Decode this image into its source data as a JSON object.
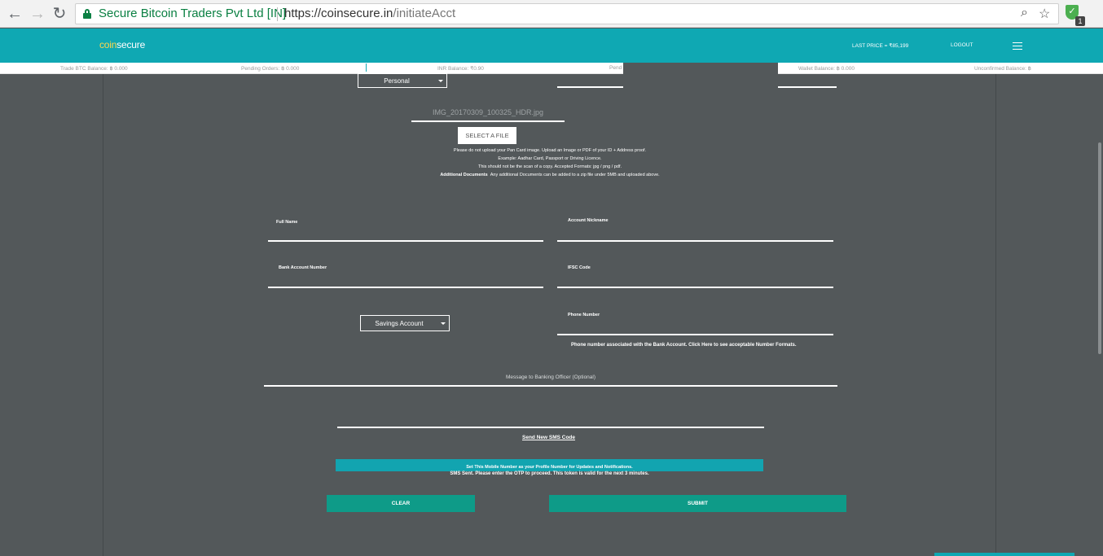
{
  "browser": {
    "site_name": "Secure Bitcoin Traders Pvt Ltd [IN]",
    "url_host": "https://coinsecure.in",
    "url_path": "/initiateAcct",
    "extension_badge": "1"
  },
  "header": {
    "logo_part1": "coin",
    "logo_part2": "secure",
    "last_price": "LAST PRICE = ₹85,199",
    "logout": "LOGOUT"
  },
  "balances": [
    {
      "label": "Trade BTC Balance: ฿ 0.000"
    },
    {
      "label": "Pending Orders: ฿ 0.000"
    },
    {
      "label": "INR Balance: ₹0.90"
    },
    {
      "label": "Pend"
    },
    {
      "label": "Wallet Balance: ฿ 0.000"
    },
    {
      "label": "Unconfirmed Balance: ฿"
    }
  ],
  "form": {
    "account_type": "Personal",
    "file_name": "IMG_20170309_100325_HDR.jpg",
    "select_file": "SELECT A FILE",
    "note_line1": "Please do not upload your Pan Card image. Upload an Image or PDF of your ID + Address proof.",
    "note_line2": "Example: Aadhar Card, Passport or Driving Licence.",
    "note_line3": "This should not be the scan of a copy. Accepted Formats: jpg / png / pdf.",
    "note_line4_bold": "Additional Documents",
    "note_line4": "Any additional Documents can be added to a zip file under 5MB and uploaded above.",
    "full_name_label": "Full Name",
    "nickname_label": "Account Nickname",
    "bank_account_label": "Bank Account Number",
    "ifsc_label": "IFSC Code",
    "bank_account_type": "Savings Account",
    "phone_label": "Phone Number",
    "phone_hint": "Phone number associated with the Bank Account. Click Here to see acceptable Number Formats.",
    "message_label": "Message to Banking Officer (Optional)",
    "sms_link": "Send New SMS Code",
    "set_mobile": "Set This Mobile Number as your Profile Number for Updates and Notifications.",
    "sms_sent": "SMS Sent. Please enter the OTP to proceed. This token is valid for the next 3 minutes.",
    "clear": "CLEAR",
    "submit": "SUBMIT"
  },
  "colors": {
    "teal": "#0fa8b3",
    "green_button": "#0e9b88",
    "background": "#53585a",
    "logo_yellow": "#ffd54a"
  }
}
